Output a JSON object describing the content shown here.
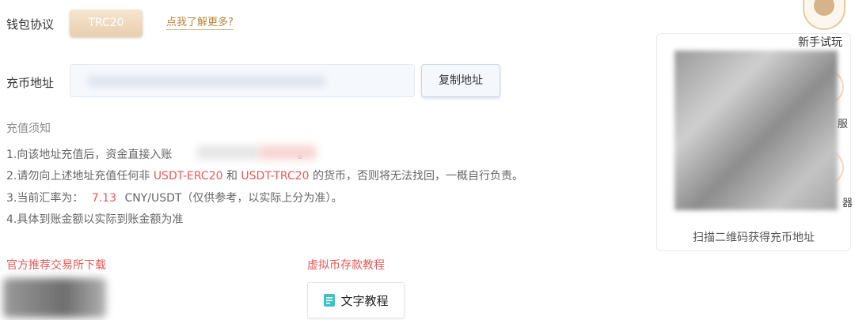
{
  "wallet": {
    "protocol_label": "钱包协议",
    "protocol_value": "TRC20",
    "learn_more": "点我了解更多?"
  },
  "address": {
    "label": "充币地址",
    "value": "",
    "copy_button": "复制地址"
  },
  "notice": {
    "title": "充值须知",
    "line1_prefix": "1.向该地址充值后，资金直接入账",
    "line1_suffix": "。",
    "line2_prefix": "2.请勿向上述地址充值任何非",
    "line2_token1": "USDT-ERC20",
    "line2_and": "和",
    "line2_token2": "USDT-TRC20",
    "line2_suffix": "的货币，否则将无法找回，一概自行负责。",
    "line3_prefix": "3.当前汇率为：",
    "line3_rate": "7.13",
    "line3_suffix": "CNY/USDT（仅供参考，以实际上分为准）。",
    "line4": "4.具体到账金额以实际到账金额为准"
  },
  "downloads": {
    "exchange_title": "官方推荐交易所下载",
    "tutorial_title": "虚拟币存款教程",
    "tutorial_button": "文字教程"
  },
  "qr": {
    "caption": "扫描二维码获得充币地址"
  },
  "floating": {
    "trial_label": "新手试玩",
    "partial_service": "服",
    "partial_device": "器"
  },
  "colors": {
    "accent_red": "#e35a57",
    "gold": "#b5853f",
    "protocol_button": "#e9cfae"
  }
}
